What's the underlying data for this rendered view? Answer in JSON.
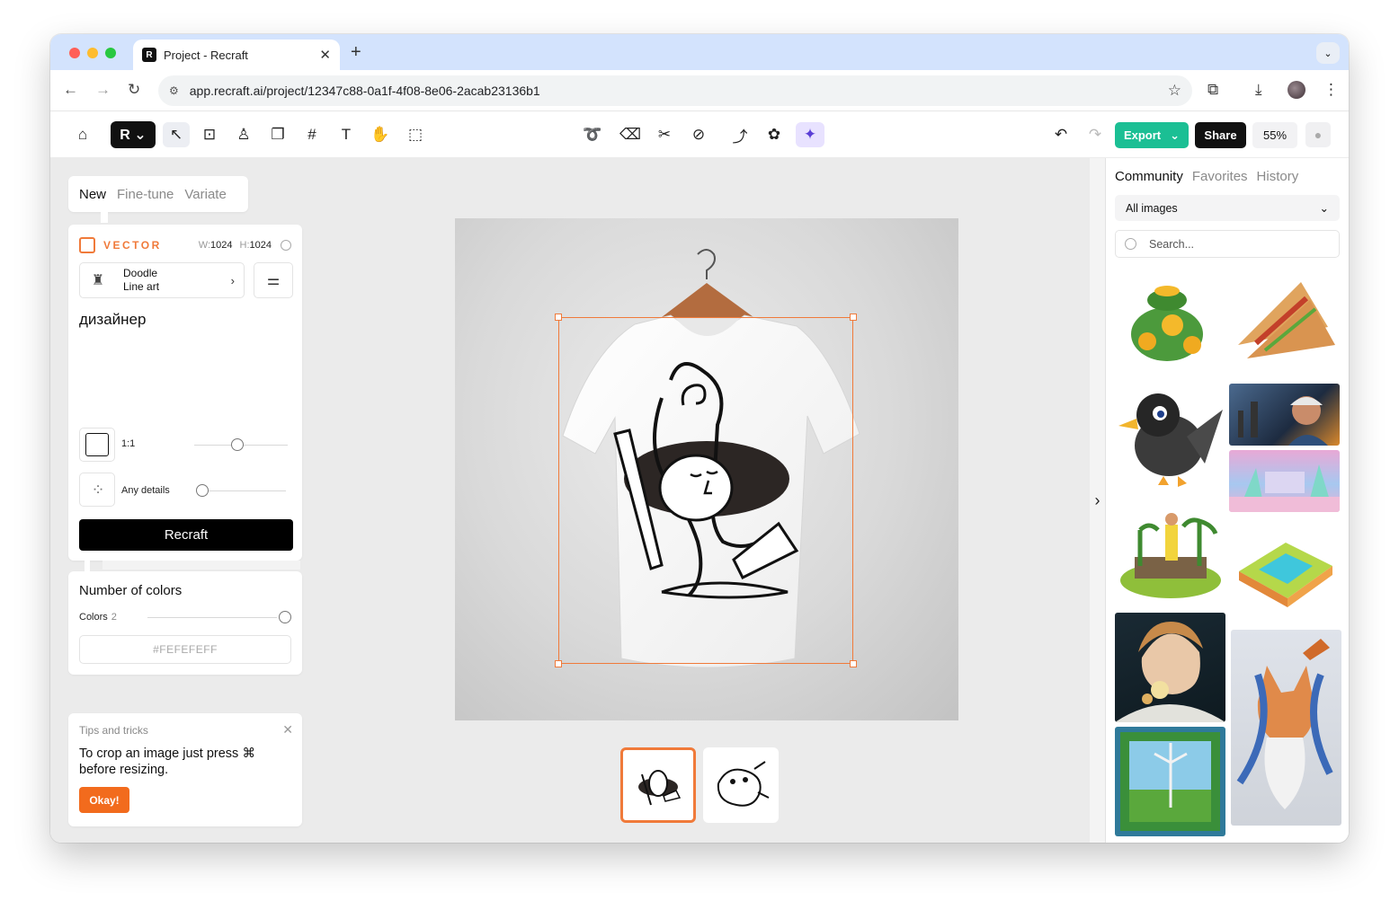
{
  "browser": {
    "tab_title": "Project - Recraft",
    "tab_favicon": "R",
    "new_tab": "+",
    "url": "app.recraft.ai/project/12347c88-0a1f-4f08-8e06-2acab23136b1"
  },
  "toolbar": {
    "export_label": "Export",
    "share_label": "Share",
    "zoom": "55%"
  },
  "left_panel": {
    "mode_tabs": [
      "New",
      "Fine-tune",
      "Variate"
    ],
    "selected_mode": "New",
    "vector_label": "VECTOR",
    "width_label": "W:",
    "width_value": "1024",
    "height_label": "H:",
    "height_value": "1024",
    "style_line1": "Doodle",
    "style_line2": "Line art",
    "prompt": "дизайнер",
    "aspect_ratio": "1:1",
    "details_label": "Any details",
    "generate_label": "Recraft",
    "colors_title": "Number of colors",
    "colors_label": "Colors",
    "colors_value": "2",
    "color_hex": "#FEFEFEFF",
    "tips_title": "Tips and tricks",
    "tips_text": "To crop an image just press ⌘ before resizing.",
    "tips_button": "Okay!"
  },
  "right_panel": {
    "tabs": [
      "Community",
      "Favorites",
      "History"
    ],
    "selected_tab": "Community",
    "filter_value": "All images",
    "search_placeholder": "Search..."
  },
  "colors": {
    "accent_orange": "#f07a3a",
    "export_green": "#1bbf94",
    "okay_orange": "#f26b1d"
  }
}
